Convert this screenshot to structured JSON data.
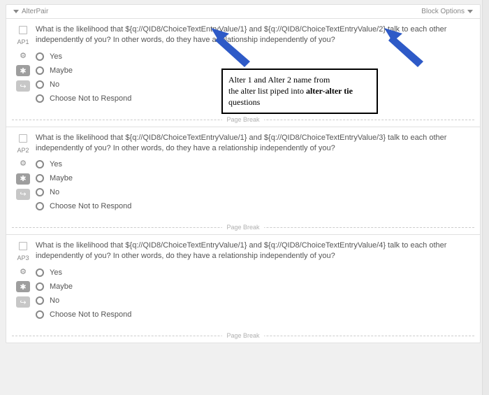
{
  "block": {
    "title": "AlterPair",
    "options_label": "Block Options"
  },
  "page_break_label": "Page Break",
  "annotation": {
    "line1": "Alter 1 and Alter 2 name from",
    "line2_pre": "the alter list piped into ",
    "line2_bold": "alter-alter tie",
    "line3": " questions"
  },
  "questions": [
    {
      "id": "AP1",
      "text": "What is the likelihood that ${q://QID8/ChoiceTextEntryValue/1} and ${q://QID8/ChoiceTextEntryValue/2} talk to each other independently of you? In other words, do they have a relationship independently of you?",
      "choices": [
        "Yes",
        "Maybe",
        "No",
        "Choose Not to Respond"
      ]
    },
    {
      "id": "AP2",
      "text": "What is the likelihood that ${q://QID8/ChoiceTextEntryValue/1} and ${q://QID8/ChoiceTextEntryValue/3} talk to each other independently of you? In other words, do they have a relationship independently of you?",
      "choices": [
        "Yes",
        "Maybe",
        "No",
        "Choose Not to Respond"
      ]
    },
    {
      "id": "AP3",
      "text": "What is the likelihood that ${q://QID8/ChoiceTextEntryValue/1} and ${q://QID8/ChoiceTextEntryValue/4} talk to each other independently of you? In other words, do they have a relationship independently of you?",
      "choices": [
        "Yes",
        "Maybe",
        "No",
        "Choose Not to Respond"
      ]
    }
  ]
}
